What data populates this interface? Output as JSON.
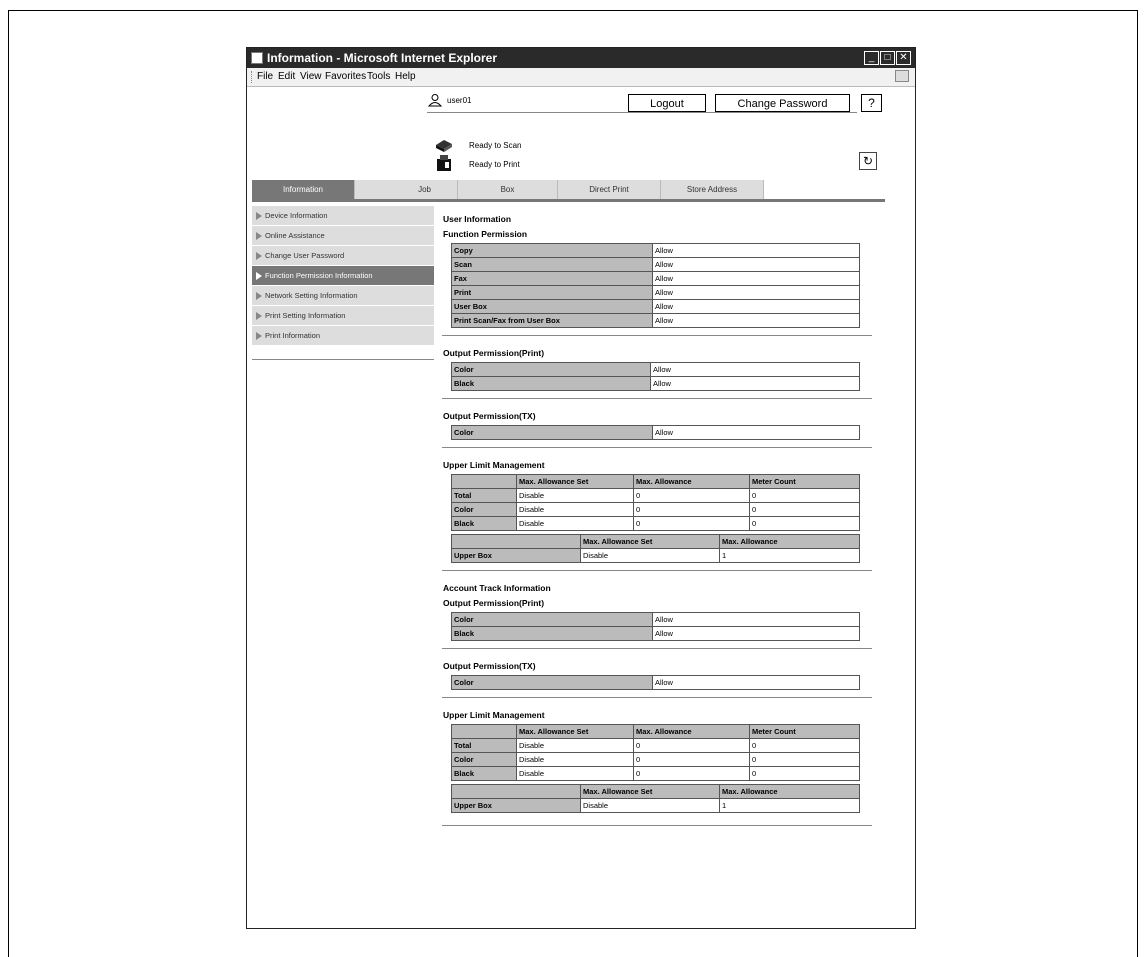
{
  "window": {
    "title": "Information - Microsoft Internet Explorer"
  },
  "menu": [
    "File",
    "Edit",
    "View",
    "Favorites",
    "Tools",
    "Help"
  ],
  "header": {
    "username": "user01",
    "logout_label": "Logout",
    "change_password_label": "Change Password",
    "help_label": "?",
    "scan_status": "Ready to Scan",
    "print_status": "Ready to Print"
  },
  "tabs": [
    "Information",
    "Job",
    "Box",
    "Direct Print",
    "Store Address"
  ],
  "sidebar": {
    "items": [
      "Device Information",
      "Online Assistance",
      "Change User Password",
      "Function Permission Information",
      "Network Setting Information",
      "Print Setting Information",
      "Print Information"
    ]
  },
  "main": {
    "user_info_title": "User Information",
    "function_permission_title": "Function Permission",
    "function_permission": [
      {
        "label": "Copy",
        "value": "Allow"
      },
      {
        "label": "Scan",
        "value": "Allow"
      },
      {
        "label": "Fax",
        "value": "Allow"
      },
      {
        "label": "Print",
        "value": "Allow"
      },
      {
        "label": "User Box",
        "value": "Allow"
      },
      {
        "label": "Print Scan/Fax from User Box",
        "value": "Allow"
      }
    ],
    "output_print_title": "Output Permission(Print)",
    "output_print": [
      {
        "label": "Color",
        "value": "Allow"
      },
      {
        "label": "Black",
        "value": "Allow"
      }
    ],
    "output_tx_title": "Output Permission(TX)",
    "output_tx": [
      {
        "label": "Color",
        "value": "Allow"
      }
    ],
    "upper_limit_title": "Upper Limit Management",
    "upper_headers": [
      "Max. Allowance Set",
      "Max. Allowance",
      "Meter Count"
    ],
    "upper_rows": [
      {
        "label": "Total",
        "set": "Disable",
        "max": "0",
        "count": "0"
      },
      {
        "label": "Color",
        "set": "Disable",
        "max": "0",
        "count": "0"
      },
      {
        "label": "Black",
        "set": "Disable",
        "max": "0",
        "count": "0"
      }
    ],
    "box_headers": [
      "Max. Allowance Set",
      "Max. Allowance"
    ],
    "box_row": {
      "label": "Upper Box",
      "set": "Disable",
      "max": "1"
    },
    "account_track_title": "Account Track Information",
    "acct_output_print_title": "Output Permission(Print)",
    "acct_output_print": [
      {
        "label": "Color",
        "value": "Allow"
      },
      {
        "label": "Black",
        "value": "Allow"
      }
    ],
    "acct_output_tx_title": "Output Permission(TX)",
    "acct_output_tx": [
      {
        "label": "Color",
        "value": "Allow"
      }
    ],
    "acct_upper_limit_title": "Upper Limit Management",
    "acct_upper_rows": [
      {
        "label": "Total",
        "set": "Disable",
        "max": "0",
        "count": "0"
      },
      {
        "label": "Color",
        "set": "Disable",
        "max": "0",
        "count": "0"
      },
      {
        "label": "Black",
        "set": "Disable",
        "max": "0",
        "count": "0"
      }
    ],
    "acct_box_row": {
      "label": "Upper Box",
      "set": "Disable",
      "max": "1"
    }
  }
}
